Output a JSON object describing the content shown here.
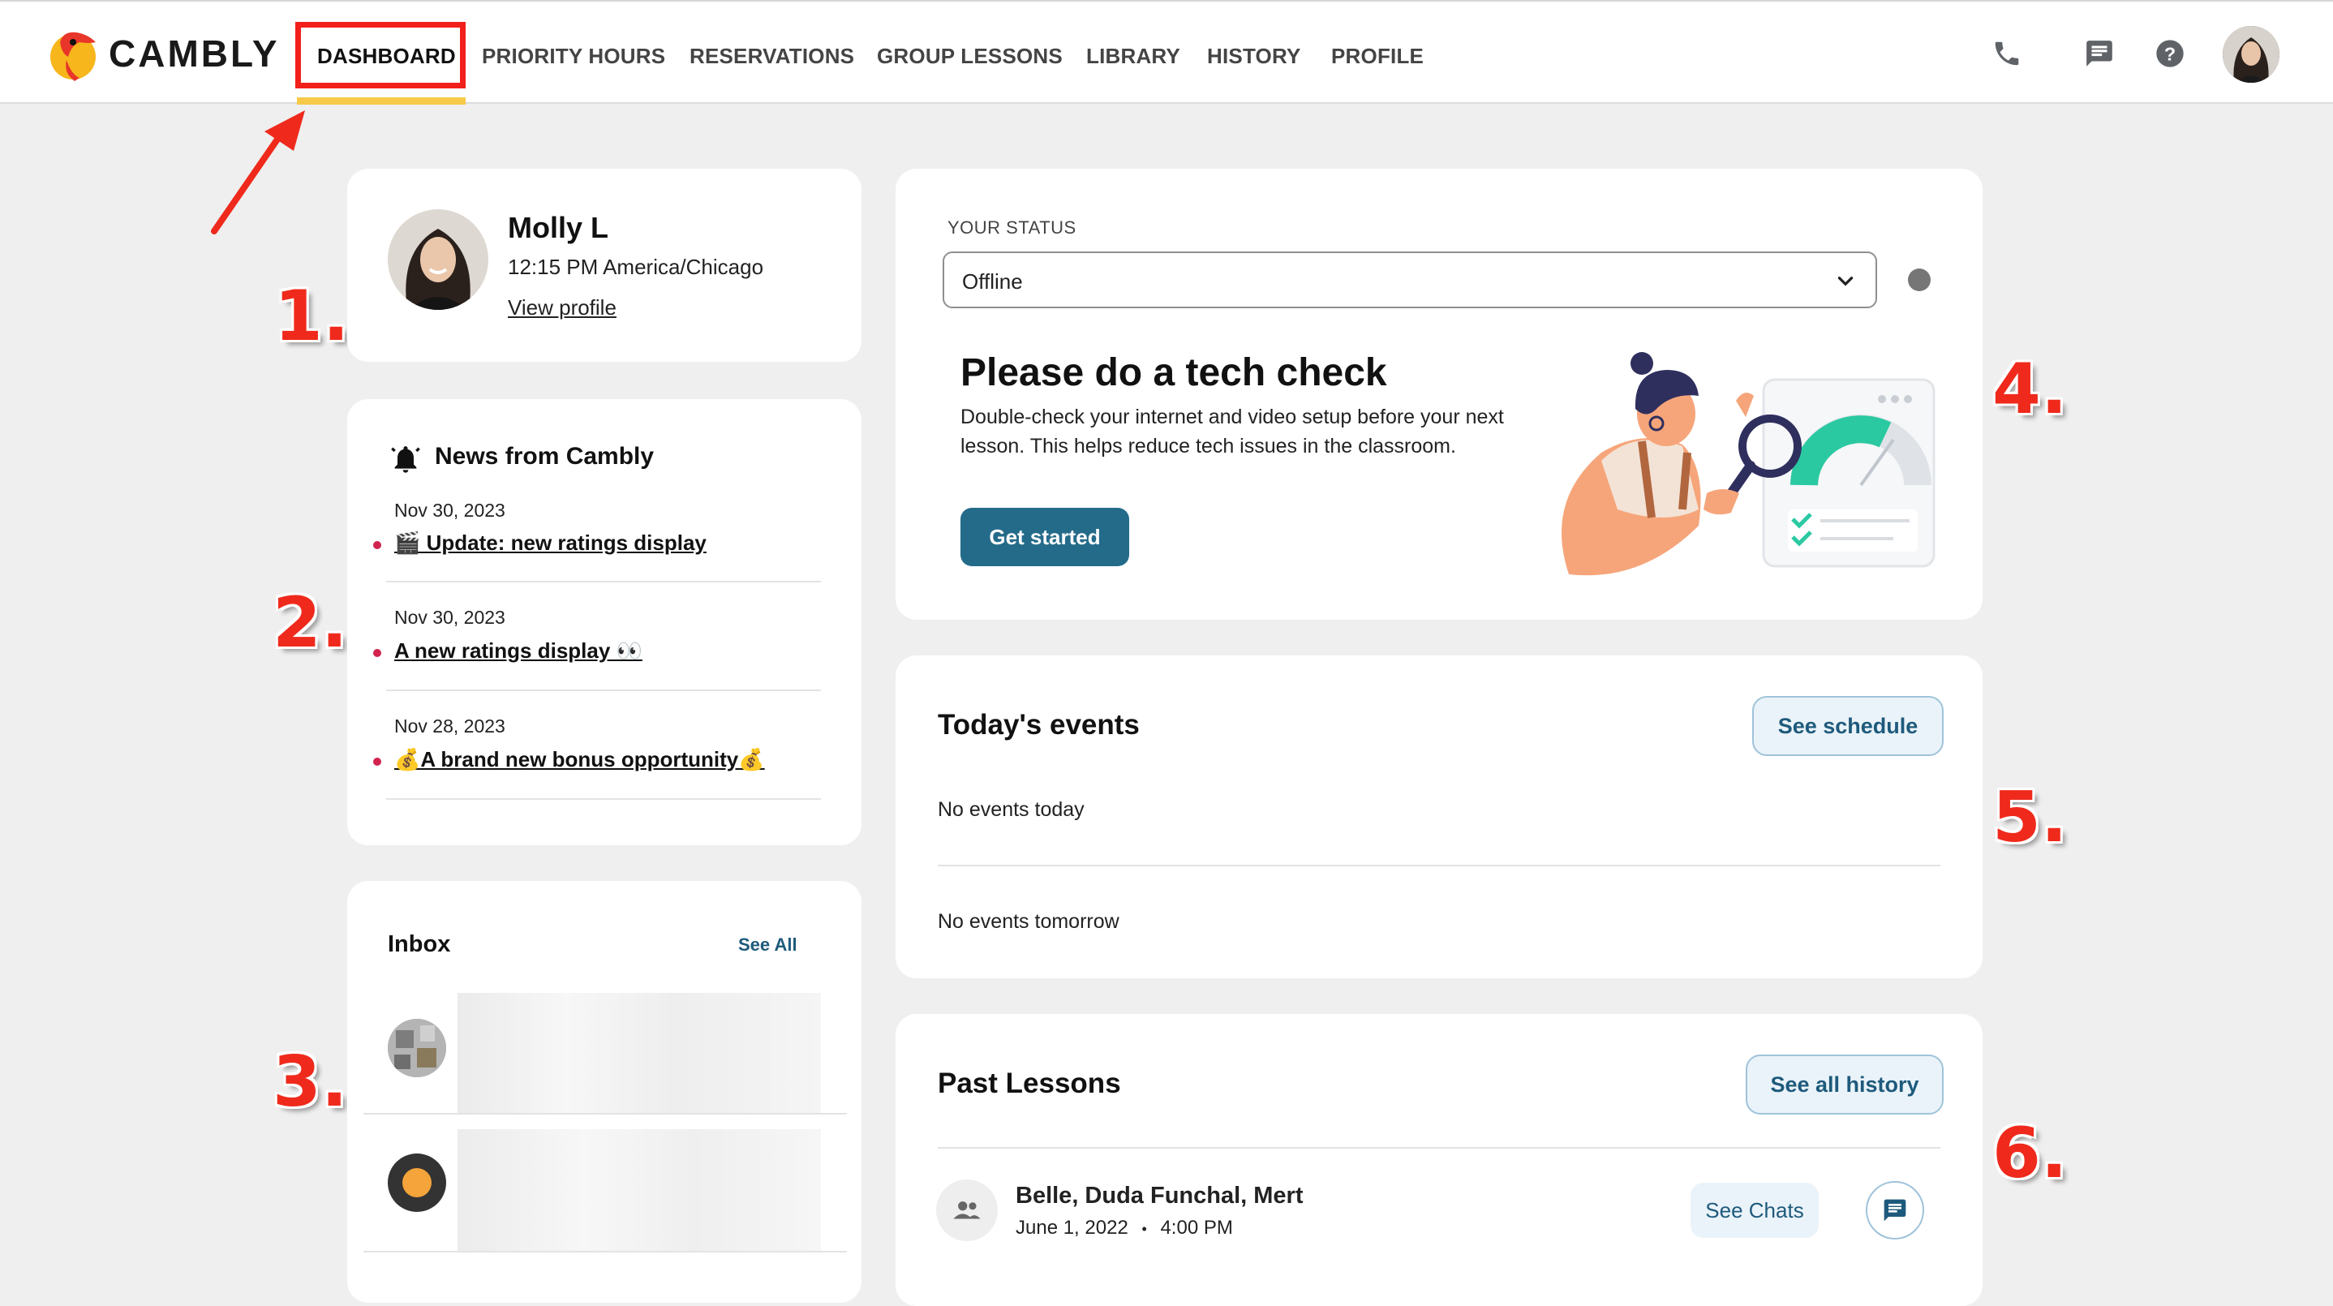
{
  "header": {
    "brand": "CAMBLY",
    "nav": [
      {
        "label": "DASHBOARD"
      },
      {
        "label": "PRIORITY HOURS"
      },
      {
        "label": "RESERVATIONS"
      },
      {
        "label": "GROUP LESSONS"
      },
      {
        "label": "LIBRARY"
      },
      {
        "label": "HISTORY"
      },
      {
        "label": "PROFILE"
      }
    ],
    "icons": [
      "phone-icon",
      "chat-icon",
      "help-icon",
      "avatar"
    ]
  },
  "annotations": {
    "numbers": [
      "1.",
      "2.",
      "3.",
      "4.",
      "5.",
      "6."
    ],
    "highlight_color": "#ef2a1c",
    "underline_color": "#f7c948"
  },
  "profile": {
    "name": "Molly L",
    "time": "12:15 PM America/Chicago",
    "view_profile": "View profile"
  },
  "news": {
    "title": "News from Cambly",
    "items": [
      {
        "date": "Nov 30, 2023",
        "title": "🎬 Update: new ratings display"
      },
      {
        "date": "Nov 30, 2023",
        "title": "A new ratings display 👀"
      },
      {
        "date": "Nov 28, 2023",
        "title": "💰A brand new bonus opportunity💰"
      }
    ]
  },
  "inbox": {
    "title": "Inbox",
    "see_all": "See All"
  },
  "status": {
    "label": "YOUR STATUS",
    "value": "Offline",
    "tech_title": "Please do a tech check",
    "tech_body_1": "Double-check your internet and video setup before your next",
    "tech_body_2": "lesson. This helps reduce tech issues in the classroom.",
    "cta": "Get started",
    "accent": "#246b8a"
  },
  "events": {
    "title": "Today's events",
    "see_schedule": "See schedule",
    "today": "No events today",
    "tomorrow": "No events tomorrow"
  },
  "past": {
    "title": "Past Lessons",
    "see_history": "See all history",
    "lesson": {
      "names": "Belle, Duda Funchal, Mert",
      "date": "June 1, 2022",
      "time": "4:00 PM",
      "see_chats": "See Chats"
    }
  }
}
